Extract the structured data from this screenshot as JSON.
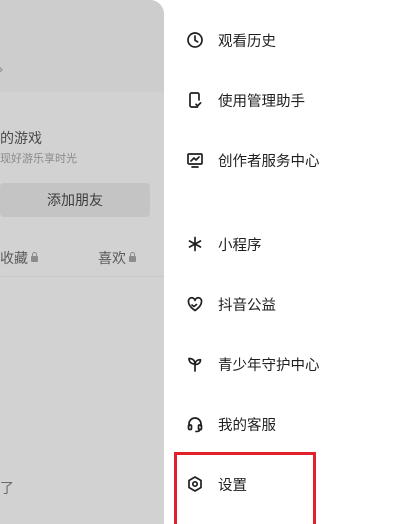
{
  "background_profile": {
    "game_title": "的游戏",
    "game_subtitle": "现好游乐享时光",
    "add_friend_label": "添加朋友",
    "tabs": [
      {
        "label": "收藏"
      },
      {
        "label": "喜欢"
      }
    ],
    "bottom_text": "了"
  },
  "menu": {
    "items": [
      {
        "label": "观看历史",
        "icon": "clock-icon"
      },
      {
        "label": "使用管理助手",
        "icon": "phone-check-icon"
      },
      {
        "label": "创作者服务中心",
        "icon": "chart-monitor-icon"
      },
      {
        "label": "小程序",
        "icon": "asterisk-icon"
      },
      {
        "label": "抖音公益",
        "icon": "heart-hands-icon"
      },
      {
        "label": "青少年守护中心",
        "icon": "sprout-icon"
      },
      {
        "label": "我的客服",
        "icon": "headset-icon"
      },
      {
        "label": "设置",
        "icon": "hexagon-gear-icon"
      }
    ]
  },
  "colors": {
    "highlight": "#e0202c",
    "dim_overlay": "#d2d2d2"
  }
}
